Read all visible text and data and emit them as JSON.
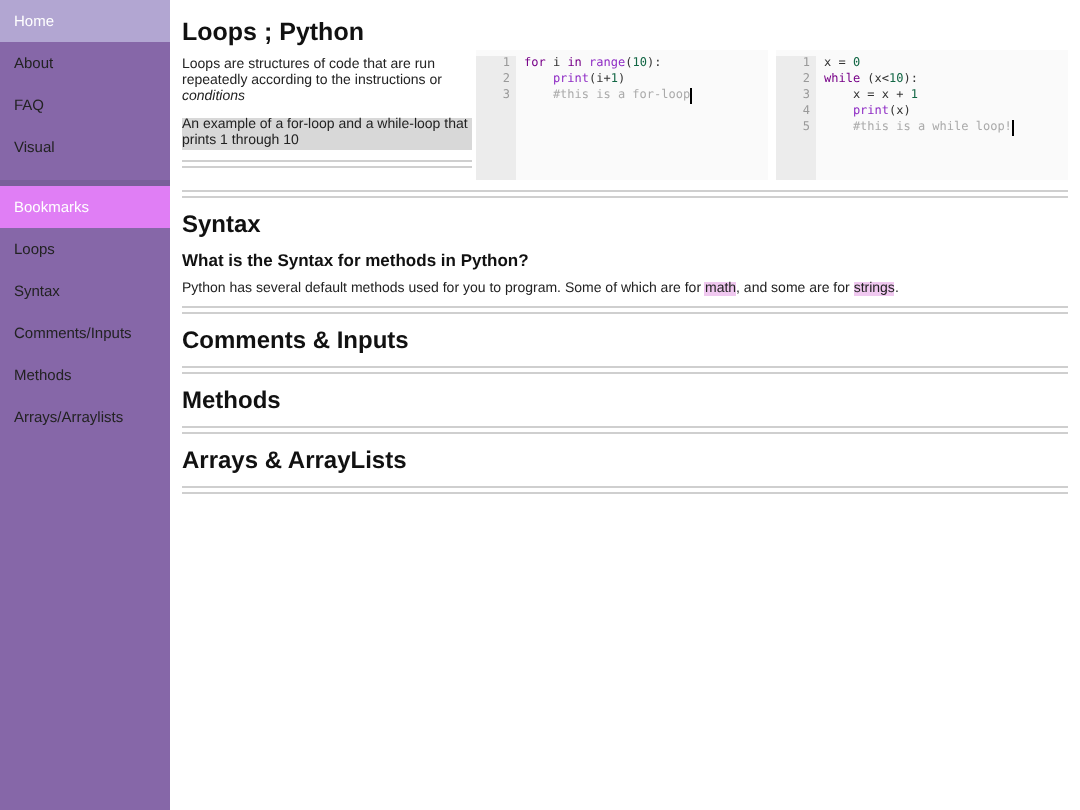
{
  "sidebar": {
    "items": [
      {
        "label": "Home",
        "kind": "link",
        "selected": true
      },
      {
        "label": "About",
        "kind": "link",
        "selected": false
      },
      {
        "label": "FAQ",
        "kind": "link",
        "selected": false
      },
      {
        "label": "Visual",
        "kind": "link",
        "selected": false
      },
      {
        "label": "Bookmarks",
        "kind": "header"
      },
      {
        "label": "Loops",
        "kind": "link",
        "selected": false
      },
      {
        "label": "Syntax",
        "kind": "link",
        "selected": false
      },
      {
        "label": "Comments/Inputs",
        "kind": "link",
        "selected": false
      },
      {
        "label": "Methods",
        "kind": "link",
        "selected": false
      },
      {
        "label": "Arrays/Arraylists",
        "kind": "link",
        "selected": false
      }
    ]
  },
  "intro": {
    "title": "Loops ; Python",
    "description": "Loops are structures of code that are run repeatedly according to the instructions or *conditions*",
    "caption": "An example of a for-loop and a while-loop that prints 1 through 10",
    "editors": [
      {
        "lines": [
          {
            "number": "1",
            "cursor": false,
            "tokens": [
              {
                "kind": "keyword",
                "text": "for"
              },
              {
                "kind": "plain",
                "text": " i "
              },
              {
                "kind": "keyword",
                "text": "in"
              },
              {
                "kind": "function",
                "text": " range"
              },
              {
                "kind": "plain",
                "text": "("
              },
              {
                "kind": "number",
                "text": "10"
              },
              {
                "kind": "plain",
                "text": "):"
              }
            ]
          },
          {
            "number": "2",
            "cursor": false,
            "tokens": [
              {
                "kind": "function",
                "text": "    print"
              },
              {
                "kind": "plain",
                "text": "(i+"
              },
              {
                "kind": "number",
                "text": "1"
              },
              {
                "kind": "plain",
                "text": ")"
              }
            ]
          },
          {
            "number": "3",
            "cursor": true,
            "tokens": [
              {
                "kind": "comment",
                "text": "    #this is a for-loop"
              }
            ]
          }
        ]
      },
      {
        "lines": [
          {
            "number": "1",
            "cursor": false,
            "tokens": [
              {
                "kind": "plain",
                "text": "x = "
              },
              {
                "kind": "number",
                "text": "0"
              }
            ]
          },
          {
            "number": "2",
            "cursor": false,
            "tokens": [
              {
                "kind": "keyword",
                "text": "while"
              },
              {
                "kind": "plain",
                "text": " (x<"
              },
              {
                "kind": "number",
                "text": "10"
              },
              {
                "kind": "plain",
                "text": "):"
              }
            ]
          },
          {
            "number": "3",
            "cursor": false,
            "tokens": [
              {
                "kind": "plain",
                "text": "    x = x + "
              },
              {
                "kind": "number",
                "text": "1"
              }
            ]
          },
          {
            "number": "4",
            "cursor": false,
            "tokens": [
              {
                "kind": "function",
                "text": "    print"
              },
              {
                "kind": "plain",
                "text": "(x)"
              }
            ]
          },
          {
            "number": "5",
            "cursor": true,
            "tokens": [
              {
                "kind": "comment",
                "text": "    #this is a while loop!"
              }
            ]
          }
        ]
      }
    ]
  },
  "sections": [
    {
      "title": "Syntax",
      "subheading": "What is the Syntax for methods in Python?",
      "paragraph": [
        {
          "text": "Python has several default methods used for you to program. Some of which are for ",
          "highlighted": false
        },
        {
          "text": "math",
          "highlighted": true
        },
        {
          "text": ", and some are for ",
          "highlighted": false
        },
        {
          "text": "strings",
          "highlighted": true
        },
        {
          "text": ".",
          "highlighted": false
        }
      ]
    },
    {
      "title": "Comments & Inputs"
    },
    {
      "title": "Methods"
    },
    {
      "title": "Arrays & ArrayLists"
    }
  ]
}
